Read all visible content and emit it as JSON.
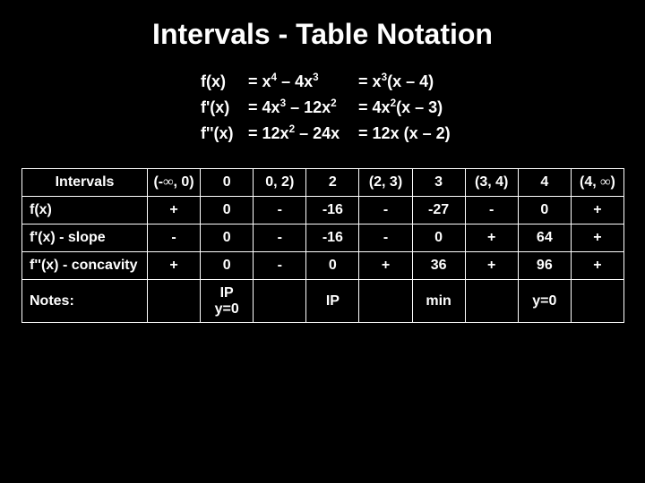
{
  "title": "Intervals - Table Notation",
  "equations": {
    "f": {
      "lhs": "f(x)",
      "mid_html": "= x<sup>4</sup> – 4x<sup>3</sup>",
      "rhs_html": "= x<sup>3</sup>(x – 4)"
    },
    "fp": {
      "lhs": "f'(x)",
      "mid_html": "= 4x<sup>3</sup> – 12x<sup>2</sup>",
      "rhs_html": "= 4x<sup>2</sup>(x – 3)"
    },
    "fpp": {
      "lhs": "f''(x)",
      "mid_html": "= 12x<sup>2</sup> – 24x",
      "rhs_html": "= 12x (x – 2)"
    }
  },
  "table": {
    "header_label": "Intervals",
    "columns_html": [
      "(-<span class='infin'>∞</span>, 0)",
      "0",
      "0, 2)",
      "2",
      "(2, 3)",
      "3",
      "(3, 4)",
      "4",
      "(4, <span class='infin'>∞</span>)"
    ],
    "rows": [
      {
        "label": "f(x)",
        "cells": [
          "+",
          "0",
          "-",
          "-16",
          "-",
          "-27",
          "-",
          "0",
          "+"
        ]
      },
      {
        "label": "f'(x) - slope",
        "cells": [
          "-",
          "0",
          "-",
          "-16",
          "-",
          "0",
          "+",
          "64",
          "+"
        ]
      },
      {
        "label": "f''(x) - concavity",
        "cells": [
          "+",
          "0",
          "-",
          "0",
          "+",
          "36",
          "+",
          "96",
          "+"
        ]
      }
    ],
    "notes": {
      "label": "Notes:",
      "cells": [
        "",
        "IP\ny=0",
        "",
        "IP",
        "",
        "min",
        "",
        "y=0",
        ""
      ]
    }
  }
}
